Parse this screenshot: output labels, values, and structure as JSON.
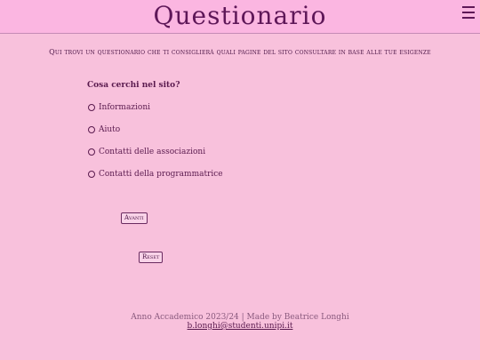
{
  "header": {
    "title": "Questionario",
    "menu_icon": "hamburger-menu-icon"
  },
  "intro": "Qui trovi un questionario che ti consiglierà quali pagine del sito consultare in base alle tue esigenze",
  "form": {
    "question": "Cosa cerchi nel sito?",
    "options": [
      "Informazioni",
      "Aiuto",
      "Contatti delle associazioni",
      "Contatti della programmatrice"
    ],
    "next_label": "Avanti",
    "reset_label": "Reset"
  },
  "footer": {
    "text": "Anno Accademico 2023/24 | Made by Beatrice Longhi",
    "email": "b.longhi@studenti.unipi.it"
  },
  "colors": {
    "background": "#f8c1dc",
    "header_bg": "#fbb6e1",
    "accent": "#5e1758"
  }
}
